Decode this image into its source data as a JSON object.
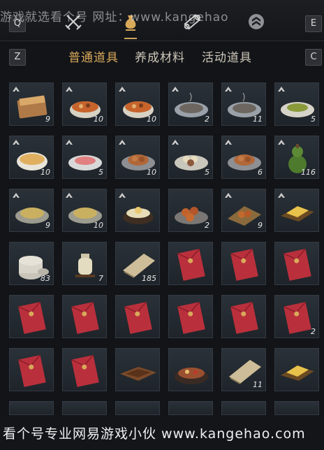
{
  "top_watermark": "游戏就选看个号 网址：www.kangehao",
  "keys": {
    "left_top": "Q",
    "right_top": "E",
    "left_tab": "Z",
    "right_tab": "C"
  },
  "top_icons": [
    {
      "name": "crossed-swords-icon",
      "active": false
    },
    {
      "name": "money-bag-icon",
      "active": true
    },
    {
      "name": "scroll-icon",
      "active": false
    },
    {
      "name": "chevron-rank-icon",
      "active": false
    }
  ],
  "tabs": [
    "普通道具",
    "养成材料",
    "活动道具"
  ],
  "active_tab": 0,
  "items": [
    {
      "icon": "cake-icon",
      "count": "9",
      "badge": true
    },
    {
      "icon": "stew-bowl-icon",
      "count": "10",
      "badge": true
    },
    {
      "icon": "stew-bowl-icon",
      "count": "10",
      "badge": true
    },
    {
      "icon": "fish-plate-icon",
      "count": "2",
      "badge": true
    },
    {
      "icon": "fish-plate-icon",
      "count": "11",
      "badge": true
    },
    {
      "icon": "greens-plate-icon",
      "count": "5",
      "badge": true
    },
    {
      "icon": "soup-bowl-icon",
      "count": "10",
      "badge": true
    },
    {
      "icon": "sashimi-plate-icon",
      "count": "5",
      "badge": true
    },
    {
      "icon": "meat-plate-icon",
      "count": "10",
      "badge": true
    },
    {
      "icon": "dumpling-plate-icon",
      "count": "5",
      "badge": true
    },
    {
      "icon": "meat-plate-icon",
      "count": "6",
      "badge": true
    },
    {
      "icon": "gourd-icon",
      "count": "116",
      "badge": true
    },
    {
      "icon": "noodle-plate-icon",
      "count": "9",
      "badge": true
    },
    {
      "icon": "noodle-plate-icon",
      "count": "10",
      "badge": true
    },
    {
      "icon": "pudding-bowl-icon",
      "count": "",
      "badge": true
    },
    {
      "icon": "fried-balls-plate-icon",
      "count": "2",
      "badge": false
    },
    {
      "icon": "fried-meat-plate-icon",
      "count": "9",
      "badge": true
    },
    {
      "icon": "gold-tray-icon",
      "count": "",
      "badge": true
    },
    {
      "icon": "clay-pot-icon",
      "count": "83",
      "badge": false
    },
    {
      "icon": "porcelain-jar-icon",
      "count": "7",
      "badge": false
    },
    {
      "icon": "paper-scroll-icon",
      "count": "185",
      "badge": false
    },
    {
      "icon": "red-envelope-icon",
      "count": "",
      "badge": false
    },
    {
      "icon": "red-envelope-icon",
      "count": "",
      "badge": false
    },
    {
      "icon": "red-envelope-icon",
      "count": "",
      "badge": false
    },
    {
      "icon": "red-envelope-icon",
      "count": "",
      "badge": false
    },
    {
      "icon": "red-envelope-icon",
      "count": "",
      "badge": false
    },
    {
      "icon": "red-envelope-icon",
      "count": "",
      "badge": false
    },
    {
      "icon": "red-envelope-icon",
      "count": "",
      "badge": false
    },
    {
      "icon": "red-envelope-icon",
      "count": "",
      "badge": false
    },
    {
      "icon": "red-envelope-icon",
      "count": "2",
      "badge": false
    },
    {
      "icon": "red-envelope-icon",
      "count": "",
      "badge": false
    },
    {
      "icon": "red-envelope-icon",
      "count": "",
      "badge": false
    },
    {
      "icon": "wooden-tray-icon",
      "count": "",
      "badge": false
    },
    {
      "icon": "hotpot-icon",
      "count": "",
      "badge": false
    },
    {
      "icon": "paper-scroll-icon",
      "count": "11",
      "badge": false
    },
    {
      "icon": "gold-tray-icon",
      "count": "",
      "badge": false
    }
  ],
  "bottom_watermark": "看个号专业网易游戏小伙 www.kangehao.com",
  "colors": {
    "accent": "#d9a95a",
    "envelope": "#b9303c",
    "slot_bg": "#242b31"
  }
}
